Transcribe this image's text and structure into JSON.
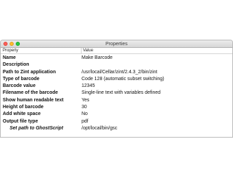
{
  "window": {
    "title": "Properties"
  },
  "columns": {
    "property": "Property",
    "value": "Value"
  },
  "rows": [
    {
      "key": "Name",
      "value": "Make Barcode"
    },
    {
      "key": "Description",
      "value": ""
    },
    {
      "key": "Path to Zint application",
      "value": "/usr/local/Cellar/zint/2.4.3_2/bin/zint"
    },
    {
      "key": "Type of barcode",
      "value": "Code 128 (automatic subset switching)"
    },
    {
      "key": "Barcode value",
      "value": "12345"
    },
    {
      "key": "Filename of the barcode",
      "value": "Single-line text with variables defined"
    },
    {
      "key": "Show human readable text",
      "value": "Yes"
    },
    {
      "key": "Height of barcode",
      "value": "30"
    },
    {
      "key": "Add white space",
      "value": "No"
    },
    {
      "key": "Output file type",
      "value": "pdf"
    },
    {
      "key": "Set path to GhostScript",
      "value": "/opt/local/bin/gsc"
    }
  ]
}
